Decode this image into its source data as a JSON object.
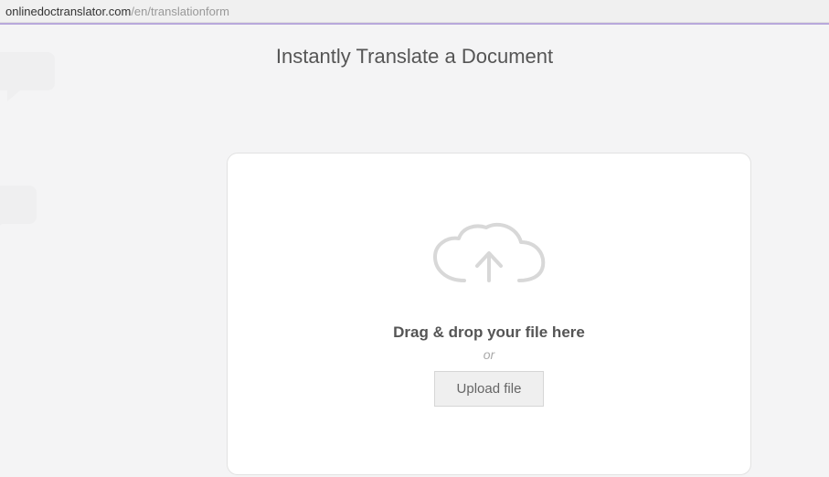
{
  "address": {
    "domain": "onlinedoctranslator.com",
    "path": "/en/translationform"
  },
  "page": {
    "title": "Instantly Translate a Document"
  },
  "upload": {
    "instruction": "Drag & drop your file here",
    "or_label": "or",
    "button_label": "Upload file"
  }
}
